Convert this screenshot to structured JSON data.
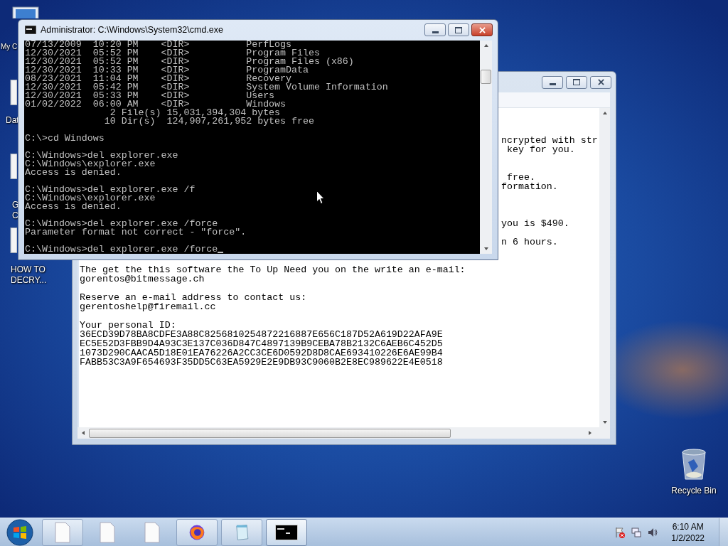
{
  "desktop_icons": [
    {
      "kind": "computer",
      "lines": [
        "My C"
      ]
    },
    {
      "kind": "document",
      "lines": [
        "Dat"
      ]
    },
    {
      "kind": "document",
      "lines": [
        "G",
        "C"
      ]
    },
    {
      "kind": "document",
      "lines": [
        "HOW TO",
        "DECRY..."
      ]
    }
  ],
  "recycle_bin": {
    "label": "Recycle Bin"
  },
  "notepad": {
    "rows": [
      {
        "kind": "covered"
      },
      {
        "kind": "covered"
      },
      {
        "kind": "covered"
      },
      {
        "kind": "peek",
        "text": "ncrypted with str"
      },
      {
        "kind": "peek",
        "text": " key for you."
      },
      {
        "kind": "covered"
      },
      {
        "kind": "covered"
      },
      {
        "kind": "peek",
        "text": " free."
      },
      {
        "kind": "peek",
        "text": "formation."
      },
      {
        "kind": "covered"
      },
      {
        "kind": "covered"
      },
      {
        "kind": "covered"
      },
      {
        "kind": "peek",
        "text": "you is $490."
      },
      {
        "kind": "covered"
      },
      {
        "kind": "peek",
        "text": "n 6 hours."
      },
      {
        "kind": "covered"
      },
      {
        "kind": "covered"
      },
      {
        "kind": "line",
        "text": "The get the this software the To Up Need you on the write an e-mail:"
      },
      {
        "kind": "line",
        "text": "gorentos@bitmessage.ch"
      },
      {
        "kind": "blank"
      },
      {
        "kind": "line",
        "text": "Reserve an e-mail address to contact us:"
      },
      {
        "kind": "line",
        "text": "gerentoshelp@firemail.cc"
      },
      {
        "kind": "blank"
      },
      {
        "kind": "line",
        "text": "Your personal ID:"
      },
      {
        "kind": "line",
        "text": "36ECD39D78BA8CDFE3A88C825681025487221688​7E656C187D52A619D22AFA9E"
      },
      {
        "kind": "line",
        "text": "EC5E52D3FBB9D4A93C3E137C036D847C4897139B9CEBA78B2132C6AEB6C452D5"
      },
      {
        "kind": "line",
        "text": "1073D290CAACA5D18E01EA76226A2CC3CE6D0592D8D8CAE693410226E6AE99B4"
      },
      {
        "kind": "line",
        "text": "FABB53C3A9F654693F35DD5C63EA5929E2E9DB93C9060B2E8EC989622E4E0518"
      }
    ]
  },
  "cmd": {
    "title": "Administrator: C:\\Windows\\System32\\cmd.exe",
    "blocks": [
      [
        "07/13/2009  10:20 PM    <DIR>          PerfLogs",
        "12/30/2021  05:52 PM    <DIR>          Program Files",
        "12/30/2021  05:52 PM    <DIR>          Program Files (x86)",
        "12/30/2021  10:33 PM    <DIR>          ProgramData",
        "08/23/2021  11:04 PM    <DIR>          Recovery",
        "12/30/2021  05:42 PM    <DIR>          System Volume Information",
        "12/30/2021  05:33 PM    <DIR>          Users",
        "01/02/2022  06:00 AM    <DIR>          Windows",
        "               2 File(s) 15,031,394,304 bytes",
        "              10 Dir(s)  124,907,261,952 bytes free"
      ],
      [
        "C:\\>cd Windows"
      ],
      [
        "C:\\Windows>del explorer.exe",
        "C:\\Windows\\explorer.exe",
        "Access is denied."
      ],
      [
        "C:\\Windows>del explorer.exe /f",
        "C:\\Windows\\explorer.exe",
        "Access is denied."
      ],
      [
        "C:\\Windows>del explorer.exe /force",
        "Parameter format not correct - \"force\"."
      ],
      [
        "C:\\Windows>del explorer.exe /force"
      ]
    ]
  },
  "taskbar": {
    "buttons": [
      {
        "kind": "file",
        "running": true,
        "selected": false
      },
      {
        "kind": "file",
        "running": false,
        "selected": false
      },
      {
        "kind": "file",
        "running": false,
        "selected": false
      },
      {
        "kind": "browser",
        "running": true,
        "selected": false
      },
      {
        "kind": "notepad",
        "running": true,
        "selected": false
      },
      {
        "kind": "console",
        "running": true,
        "selected": true
      }
    ],
    "clock": {
      "time": "6:10 AM",
      "date": "1/2/2022"
    }
  }
}
